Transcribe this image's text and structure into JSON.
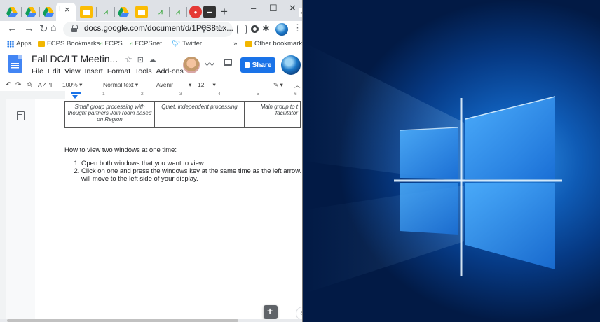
{
  "browser": {
    "tab_close_label": "×",
    "new_tab_label": "+",
    "window_controls": {
      "minimize": "–",
      "maximize": "☐",
      "close": "✕"
    },
    "url": "docs.google.com/document/d/1P6S8tLx...",
    "bookmarks": [
      {
        "label": "Apps",
        "icon": "apps-grid-icon"
      },
      {
        "label": "FCPS Bookmarks",
        "icon": "folder-icon"
      },
      {
        "label": "FCPS",
        "icon": "fcps-icon"
      },
      {
        "label": "FCPSnet",
        "icon": "fcps-icon"
      },
      {
        "label": "Twitter",
        "icon": "twitter-icon"
      },
      {
        "label": "»",
        "icon": ""
      },
      {
        "label": "Other bookmarks",
        "icon": "folder-icon"
      }
    ]
  },
  "docs": {
    "title": "Fall DC/LT Meetin...",
    "menu": [
      "File",
      "Edit",
      "View",
      "Insert",
      "Format",
      "Tools",
      "Add-ons"
    ],
    "share_label": "Share",
    "toolbar": {
      "zoom": "100%",
      "style": "Normal text",
      "font": "Avenir",
      "size": "12",
      "more": "···"
    },
    "ruler_numbers": [
      "1",
      "2",
      "3",
      "4",
      "5",
      "6"
    ],
    "table_row": [
      "Small group processing with thought partners Join room based on Region",
      "Quiet, independent processing",
      "Main group to t facilitator"
    ],
    "heading": "How to view two windows at one time:",
    "steps": [
      "Open both windows that you want to view.",
      "Click on one and press the windows key at the same time as the left arrow. will move to the left side of your display."
    ]
  },
  "colors": {
    "chrome_tabbar": "#dee1e6",
    "share_blue": "#1a73e8",
    "desktop_blue": "#0f5bb5"
  }
}
